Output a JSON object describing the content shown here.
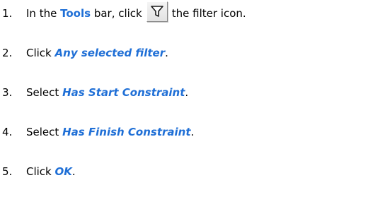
{
  "steps": [
    {
      "number": "1.",
      "before": "In the",
      "emphasis": "Tools",
      "middle": "bar, click",
      "icon": "filter-icon",
      "after": "the filter icon."
    },
    {
      "number": "2.",
      "before": "Click",
      "emphasis": "Any selected filter",
      "after": "."
    },
    {
      "number": "3.",
      "before": "Select",
      "emphasis": "Has Start Constraint",
      "after": "."
    },
    {
      "number": "4.",
      "before": "Select",
      "emphasis": "Has Finish Constraint",
      "after": "."
    },
    {
      "number": "5.",
      "before": "Click",
      "emphasis": "OK",
      "after": "."
    }
  ],
  "colors": {
    "emphasis": "#1f6fd6",
    "text": "#000000",
    "icon_face": "#e8e8e8"
  }
}
